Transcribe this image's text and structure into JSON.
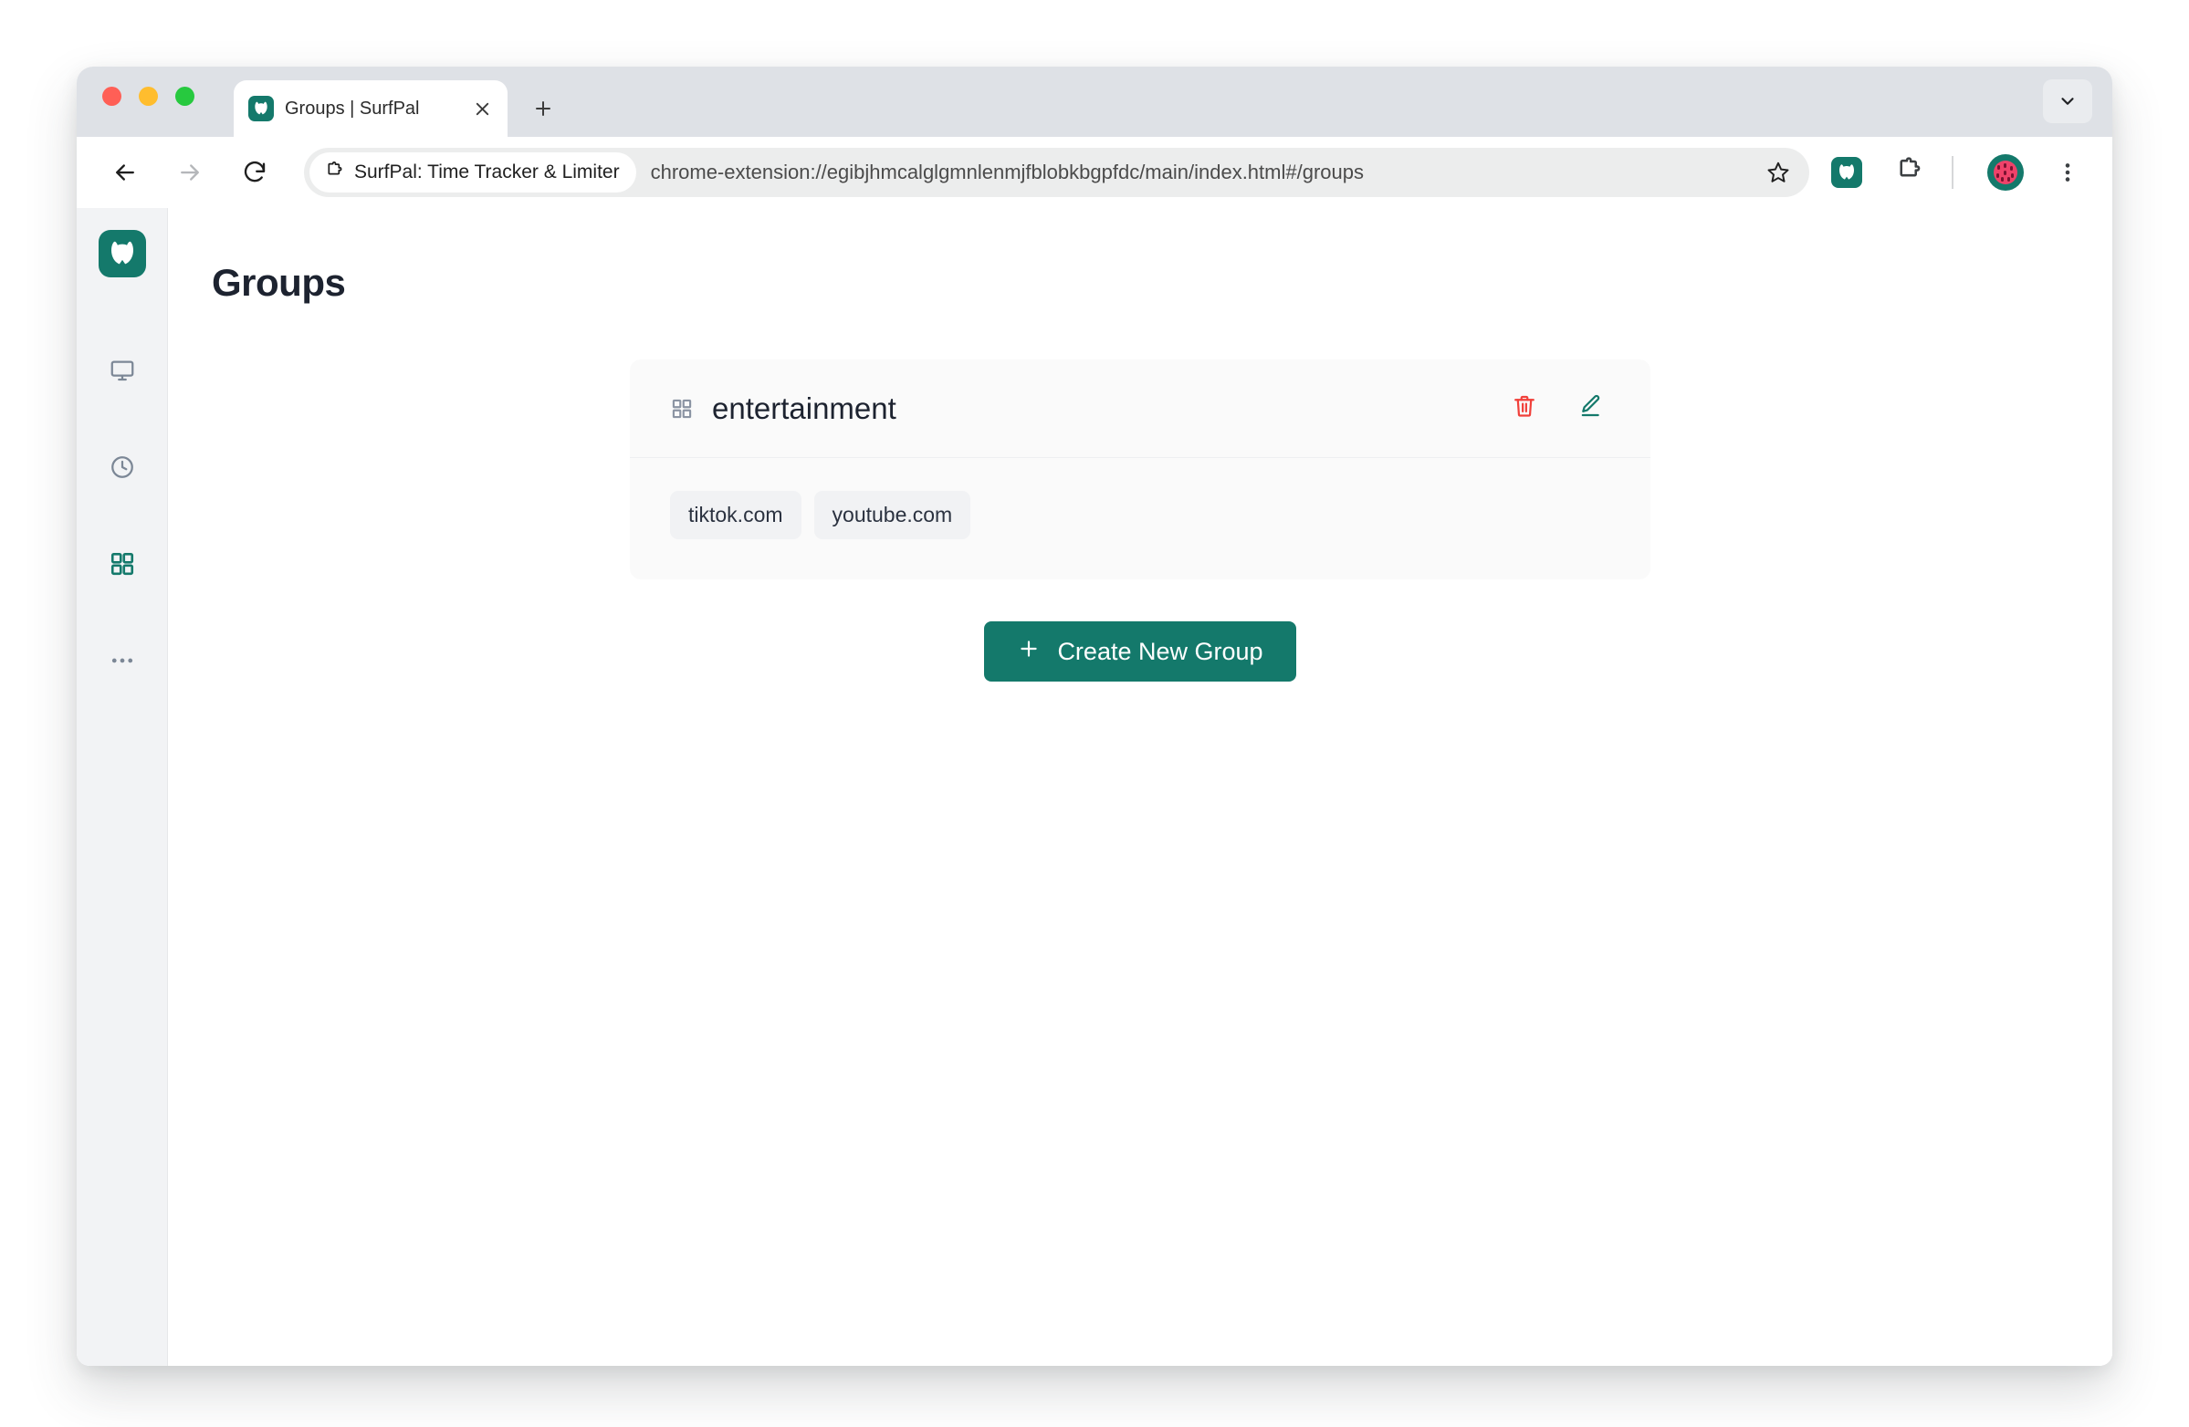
{
  "window": {
    "traffic_lights": [
      {
        "name": "close",
        "color": "#ff5f56"
      },
      {
        "name": "minimize",
        "color": "#ffbd2e"
      },
      {
        "name": "maximize",
        "color": "#27c93f"
      }
    ]
  },
  "tab_strip": {
    "tab": {
      "title": "Groups | SurfPal",
      "favicon_icon": "surfpal-cat-icon",
      "close_icon": "close-icon"
    },
    "new_tab_icon": "plus-icon",
    "tab_list_icon": "chevron-down-icon"
  },
  "toolbar": {
    "back_icon": "arrow-left-icon",
    "forward_icon": "arrow-right-icon",
    "reload_icon": "reload-icon",
    "extension_chip_label": "SurfPal: Time Tracker & Limiter",
    "extension_chip_icon": "puzzle-piece-icon",
    "url": "chrome-extension://egibjhmcalglgmnlenmjfblobkbgpfdc/main/index.html#/groups",
    "bookmark_icon": "star-icon",
    "surfpal_extension_icon": "surfpal-cat-icon",
    "extensions_icon": "puzzle-piece-icon",
    "avatar_icon": "watermelon-avatar",
    "menu_icon": "three-dots-vertical-icon"
  },
  "sidebar": {
    "logo_icon": "surfpal-cat-logo",
    "items": [
      {
        "name": "dashboard",
        "icon": "monitor-icon",
        "active": false
      },
      {
        "name": "history",
        "icon": "clock-icon",
        "active": false
      },
      {
        "name": "groups",
        "icon": "grid-icon",
        "active": true
      },
      {
        "name": "more",
        "icon": "ellipsis-icon",
        "active": false
      }
    ]
  },
  "main": {
    "page_title": "Groups",
    "groups": [
      {
        "name": "entertainment",
        "icon": "grid-icon",
        "delete_icon": "trash-icon",
        "edit_icon": "pencil-edit-icon",
        "domains": [
          "tiktok.com",
          "youtube.com"
        ]
      }
    ],
    "create_button": {
      "label": "Create New Group",
      "icon": "plus-icon"
    }
  },
  "colors": {
    "accent_teal": "#14796b",
    "danger_red": "#f1403a",
    "sidebar_bg": "#f2f3f5",
    "card_bg": "#fafafa",
    "chip_bg": "#f1f2f4",
    "title_text": "#1d2330"
  }
}
